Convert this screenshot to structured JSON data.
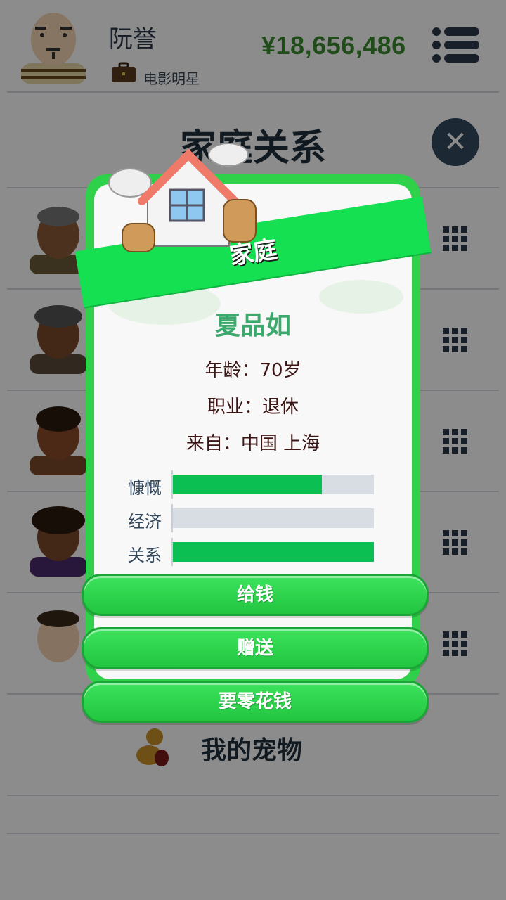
{
  "header": {
    "player_name": "阮誉",
    "job": "电影明星",
    "money": "¥18,656,486",
    "menu_icon": "menu-icon"
  },
  "family": {
    "title": "家庭关系",
    "pet_label": "我的宠物"
  },
  "modal": {
    "ribbon": "家庭",
    "name": "夏品如",
    "age_line": "年龄：70岁",
    "job_line": "职业：退休",
    "from_line": "来自：中国 上海",
    "stats": [
      {
        "label": "慷慨",
        "value": 0.74
      },
      {
        "label": "经济",
        "value": 0.0
      },
      {
        "label": "关系",
        "value": 1.0
      }
    ],
    "buttons": [
      "给钱",
      "赠送",
      "要零花钱"
    ]
  },
  "colors": {
    "money": "#3a8a2e",
    "ribbon": "#15e052",
    "bar_fill": "#0cbf52",
    "name": "#3aa96b"
  }
}
